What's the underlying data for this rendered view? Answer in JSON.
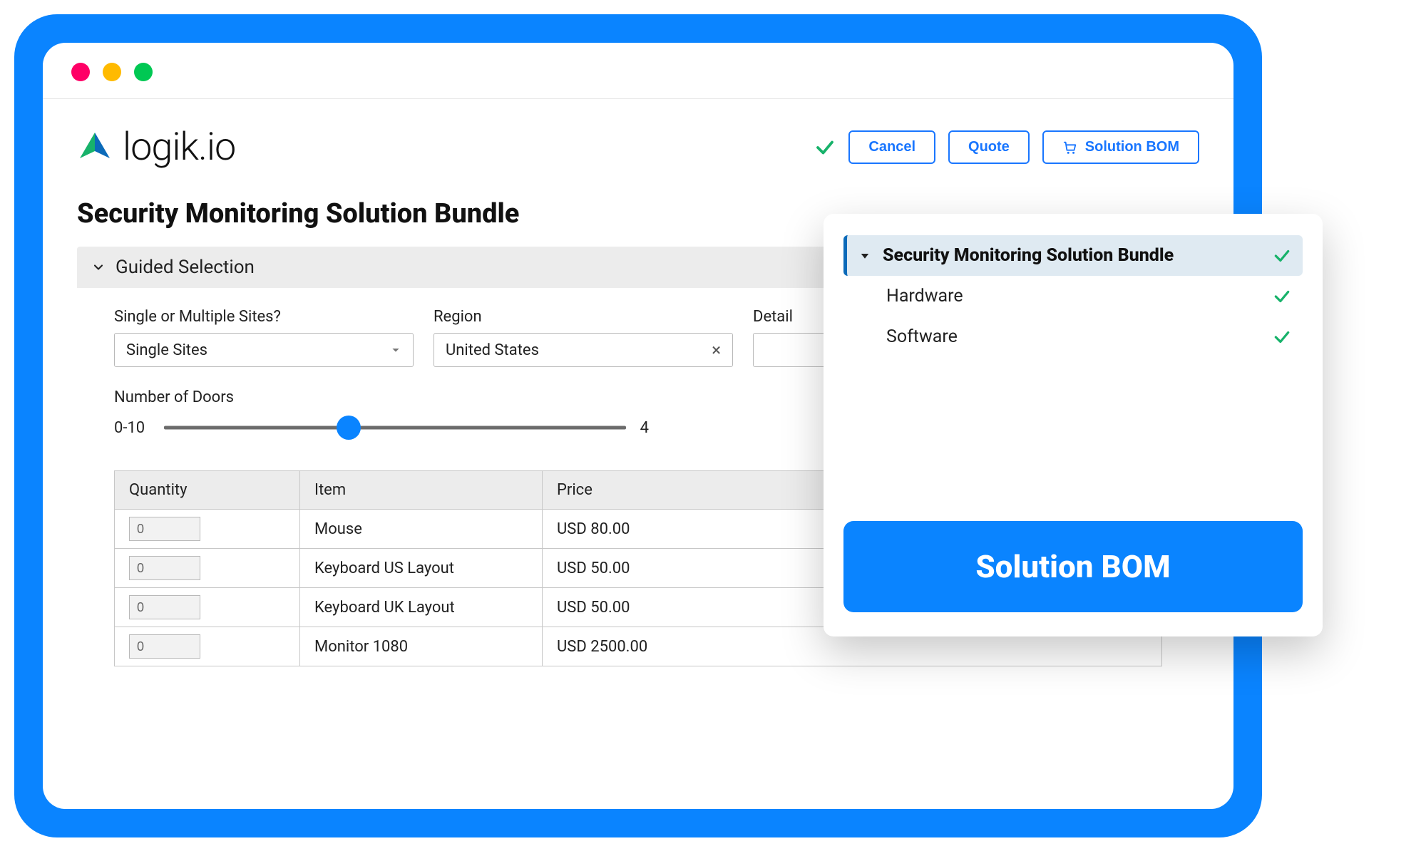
{
  "logo": {
    "text": "logik.io"
  },
  "toolbar": {
    "cancel_label": "Cancel",
    "quote_label": "Quote",
    "solution_bom_label": "Solution BOM"
  },
  "page": {
    "title": "Security Monitoring Solution Bundle"
  },
  "section": {
    "guided_label": "Guided Selection"
  },
  "form": {
    "sites_label": "Single or Multiple Sites?",
    "sites_value": "Single Sites",
    "region_label": "Region",
    "region_value": "United States",
    "detail_label": "Detail",
    "detail_value": ""
  },
  "slider": {
    "label": "Number of Doors",
    "range_label": "0-10",
    "value": "4"
  },
  "table": {
    "headers": {
      "qty": "Quantity",
      "item": "Item",
      "price": "Price"
    },
    "rows": [
      {
        "qty": "0",
        "item": "Mouse",
        "price": "USD 80.00"
      },
      {
        "qty": "0",
        "item": "Keyboard US Layout",
        "price": "USD 50.00"
      },
      {
        "qty": "0",
        "item": "Keyboard UK Layout",
        "price": "USD 50.00"
      },
      {
        "qty": "0",
        "item": "Monitor 1080",
        "price": "USD 2500.00"
      }
    ]
  },
  "panel": {
    "main": "Security Monitoring Solution Bundle",
    "children": [
      "Hardware",
      "Software"
    ],
    "cta": "Solution BOM"
  }
}
